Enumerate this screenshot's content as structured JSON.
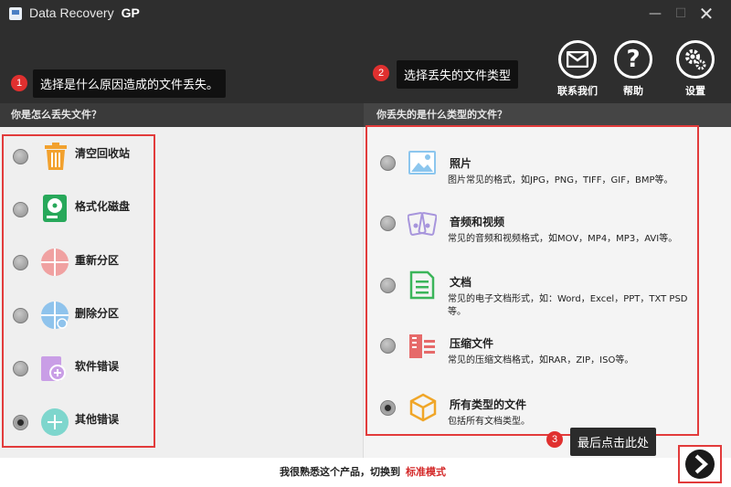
{
  "window": {
    "app_name": "Data Recovery",
    "app_edition": "GP",
    "minimize_label": "—",
    "maximize_label": "☐",
    "close_label": "✕"
  },
  "callouts": [
    {
      "num": "1",
      "text": "选择是什么原因造成的文件丢失。"
    },
    {
      "num": "2",
      "text": "选择丢失的文件类型"
    },
    {
      "num": "3",
      "text": "最后点击此处"
    }
  ],
  "toolbar": {
    "contact_label": "联系我们",
    "help_label": "帮助",
    "settings_label": "设置"
  },
  "causes_header": "你是怎么丢失文件？",
  "types_header": "你丢失的是什么类型的文件？",
  "causes": [
    {
      "label": "清空回收站",
      "icon": "recycle-bin-icon",
      "checked": false
    },
    {
      "label": "格式化磁盘",
      "icon": "format-disk-icon",
      "checked": false
    },
    {
      "label": "重新分区",
      "icon": "repartition-icon",
      "checked": false
    },
    {
      "label": "删除分区",
      "icon": "delete-partition-icon",
      "checked": false
    },
    {
      "label": "软件错误",
      "icon": "software-error-icon",
      "checked": false
    },
    {
      "label": "其他错误",
      "icon": "other-error-icon",
      "checked": true
    }
  ],
  "file_types": [
    {
      "title": "照片",
      "desc": "图片常见的格式，如JPG，PNG，TIFF，GIF，BMP等。",
      "icon": "photo-icon",
      "checked": false
    },
    {
      "title": "音频和视频",
      "desc": "常见的音频和视频格式，如MOV，MP4，MP3，AVI等。",
      "icon": "audio-video-icon",
      "checked": false
    },
    {
      "title": "文档",
      "desc": "常见的电子文档形式，如：Word，Excel，PPT，TXT PSD等。",
      "icon": "document-icon",
      "checked": false
    },
    {
      "title": "压缩文件",
      "desc": "常见的压缩文档格式，如RAR，ZIP，ISO等。",
      "icon": "archive-icon",
      "checked": false
    },
    {
      "title": "所有类型的文件",
      "desc": "包括所有文档类型。",
      "icon": "all-files-icon",
      "checked": true
    }
  ],
  "footer": {
    "prompt": "我很熟悉这个产品，切换到",
    "link": "标准模式"
  },
  "colors": {
    "header_bg": "#2e2e2e",
    "accent_red": "#e23b3b",
    "link_red": "#d42a2a"
  }
}
